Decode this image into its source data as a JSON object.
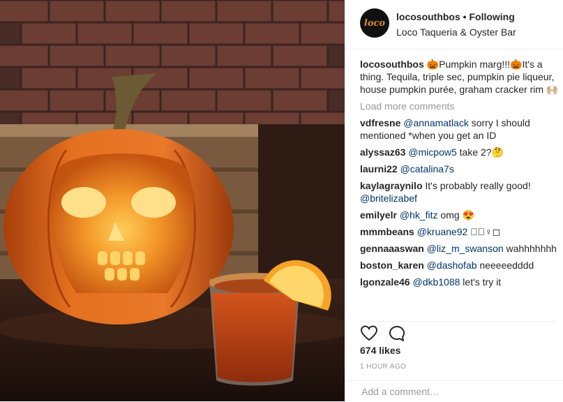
{
  "post": {
    "username": "locosouthbos",
    "follow_status": "Following",
    "separator": "•",
    "location": "Loco Taqueria & Oyster Bar",
    "avatar_text": "loco",
    "caption_user": "locosouthbos",
    "caption_text": "🎃Pumpkin marg!!!🎃It's a thing. Tequila, triple sec, pumpkin pie liqueur, house pumpkin purée, graham cracker rim 🙌🏼",
    "load_more": "Load more comments",
    "comments": [
      {
        "user": "vdfresne",
        "mention": "@annamatlack",
        "text": " sorry I should mentioned *when you get an ID"
      },
      {
        "user": "alyssaz63",
        "mention": "@micpow5",
        "text": " take 2?🤔"
      },
      {
        "user": "laurni22",
        "mention": "@catalina7s",
        "text": ""
      },
      {
        "user": "kaylagraynilo",
        "mention": "",
        "text": " It's probably really good! ",
        "mention2": "@britelizabef"
      },
      {
        "user": "emilyelr",
        "mention": "@hk_fitz",
        "text": " omg 😍"
      },
      {
        "user": "mmmbeans",
        "mention": "@kruane92",
        "text": " ◻🏼‍♀◻"
      },
      {
        "user": "gennaaaswan",
        "mention": "@liz_m_swanson",
        "text": " wahhhhhhh"
      },
      {
        "user": "boston_karen",
        "mention": "@dashofab",
        "text": " neeeeedddd"
      },
      {
        "user": "lgonzale46",
        "mention": "@dkb1088",
        "text": " let's try it"
      }
    ],
    "icons": {
      "like": "heart-icon",
      "comment": "comment-bubble-icon"
    },
    "likes": "674 likes",
    "time": "1 HOUR AGO",
    "add_comment_placeholder": "Add a comment…"
  },
  "colors": {
    "mention": "#003569",
    "muted": "#999999",
    "text": "#262626",
    "pumpkin": "#e0701c"
  }
}
